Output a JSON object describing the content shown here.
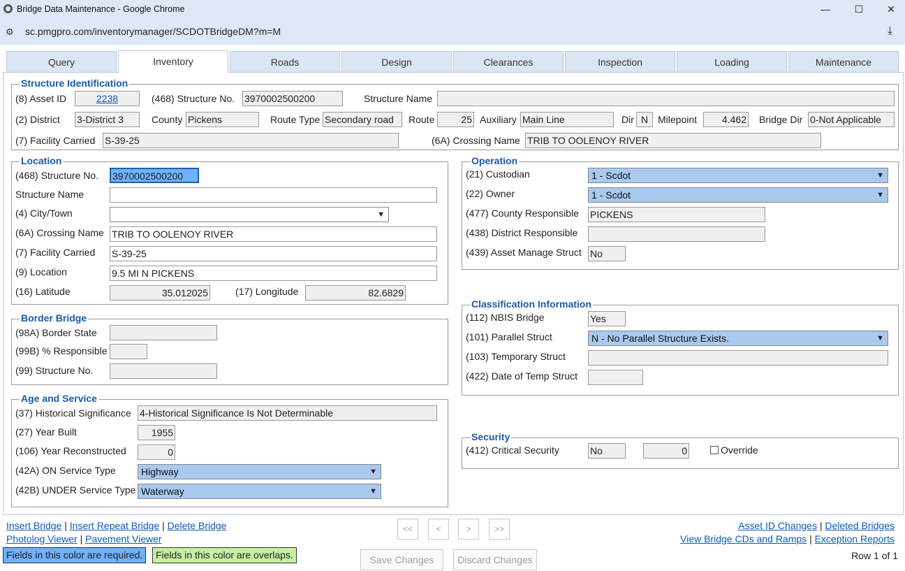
{
  "window": {
    "title": "Bridge Data Maintenance - Google Chrome",
    "minimize": "—",
    "maximize": "☐",
    "close": "✕"
  },
  "address": {
    "url": "sc.pmgpro.com/inventorymanager/SCDOTBridgeDM?m=M"
  },
  "tabs": [
    "Query",
    "Inventory",
    "Roads",
    "Design",
    "Clearances",
    "Inspection",
    "Loading",
    "Maintenance"
  ],
  "structure_identification": {
    "legend": "Structure Identification",
    "asset_id_label": "(8) Asset ID",
    "asset_id": "2238",
    "structure_no_label": "(468) Structure No.",
    "structure_no": "3970002500200",
    "structure_name_label": "Structure Name",
    "structure_name": "",
    "district_label": "(2) District",
    "district": "3-District 3",
    "county_label": "County",
    "county": "Pickens",
    "route_type_label": "Route Type",
    "route_type": "Secondary road",
    "route_label": "Route",
    "route": "25",
    "auxiliary_label": "Auxiliary",
    "auxiliary": "Main Line",
    "dir_label": "Dir",
    "dir": "N",
    "milepoint_label": "Milepoint",
    "milepoint": "4.462",
    "bridge_dir_label": "Bridge Dir",
    "bridge_dir": "0-Not Applicable",
    "facility_carried_label": "(7) Facility Carried",
    "facility_carried": "S-39-25",
    "crossing_name_label": "(6A) Crossing Name",
    "crossing_name": "TRIB TO OOLENOY RIVER"
  },
  "location": {
    "legend": "Location",
    "structure_no_label": "(468) Structure No.",
    "structure_no": "3970002500200",
    "structure_name_label": "Structure Name",
    "structure_name": "",
    "city_label": "(4) City/Town",
    "city": "",
    "crossing_name_label": "(6A) Crossing Name",
    "crossing_name": "TRIB TO OOLENOY RIVER",
    "facility_label": "(7) Facility Carried",
    "facility": "S-39-25",
    "location_label": "(9) Location",
    "location": "9.5 MI N PICKENS",
    "latitude_label": "(16) Latitude",
    "latitude": "35.012025",
    "longitude_label": "(17) Longitude",
    "longitude": "82.6829"
  },
  "border_bridge": {
    "legend": "Border Bridge",
    "state_label": "(98A) Border State",
    "state": "",
    "responsible_label": "(99B) % Responsible",
    "responsible": "",
    "structure_no_label": "(99) Structure No.",
    "structure_no": ""
  },
  "age_service": {
    "legend": "Age and Service",
    "historical_label": "(37) Historical Significance",
    "historical": "4-Historical Significance Is Not Determinable",
    "year_built_label": "(27) Year Built",
    "year_built": "1955",
    "year_recon_label": "(106) Year Reconstructed",
    "year_recon": "0",
    "on_service_label": "(42A) ON Service Type",
    "on_service": "Highway",
    "under_service_label": "(42B) UNDER Service Type",
    "under_service": "Waterway"
  },
  "operation": {
    "legend": "Operation",
    "custodian_label": "(21) Custodian",
    "custodian": "1 - Scdot",
    "owner_label": "(22) Owner",
    "owner": "1 - Scdot",
    "county_resp_label": "(477) County Responsible",
    "county_resp": "PICKENS",
    "district_resp_label": "(438) District Responsible",
    "district_resp": "",
    "asset_manage_label": "(439) Asset Manage Struct",
    "asset_manage": "No"
  },
  "classification": {
    "legend": "Classification Information",
    "nbis_label": "(112) NBIS Bridge",
    "nbis": "Yes",
    "parallel_label": "(101) Parallel Struct",
    "parallel": "N - No Parallel Structure Exists.",
    "temporary_label": "(103) Temporary Struct",
    "temporary": "",
    "temp_date_label": "(422) Date of Temp Struct",
    "temp_date": ""
  },
  "security": {
    "legend": "Security",
    "critical_label": "(412) Critical Security",
    "critical": "No",
    "critical_value": "0",
    "override_label": "Override"
  },
  "footer": {
    "insert_bridge": "Insert Bridge",
    "insert_repeat": "Insert Repeat Bridge",
    "delete_bridge": "Delete Bridge",
    "photolog": "Photolog Viewer",
    "pavement": "Pavement Viewer",
    "asset_changes": "Asset ID Changes",
    "deleted_bridges": "Deleted Bridges",
    "view_cds": "View Bridge CDs and Ramps",
    "exception_reports": "Exception Reports",
    "sep": "|",
    "nav_first": "<<",
    "nav_prev": "<",
    "nav_next": ">",
    "nav_last": ">>",
    "save": "Save Changes",
    "discard": "Discard Changes",
    "legend_required": "Fields in this color are required.",
    "legend_overlaps": "Fields in this color are overlaps.",
    "row_status": "Row 1 of 1"
  },
  "colors": {
    "required": "#6fb0ff",
    "overlaps": "#c6f0a0",
    "legend_text": "#1a5aa8",
    "link": "#0b5bb5"
  }
}
